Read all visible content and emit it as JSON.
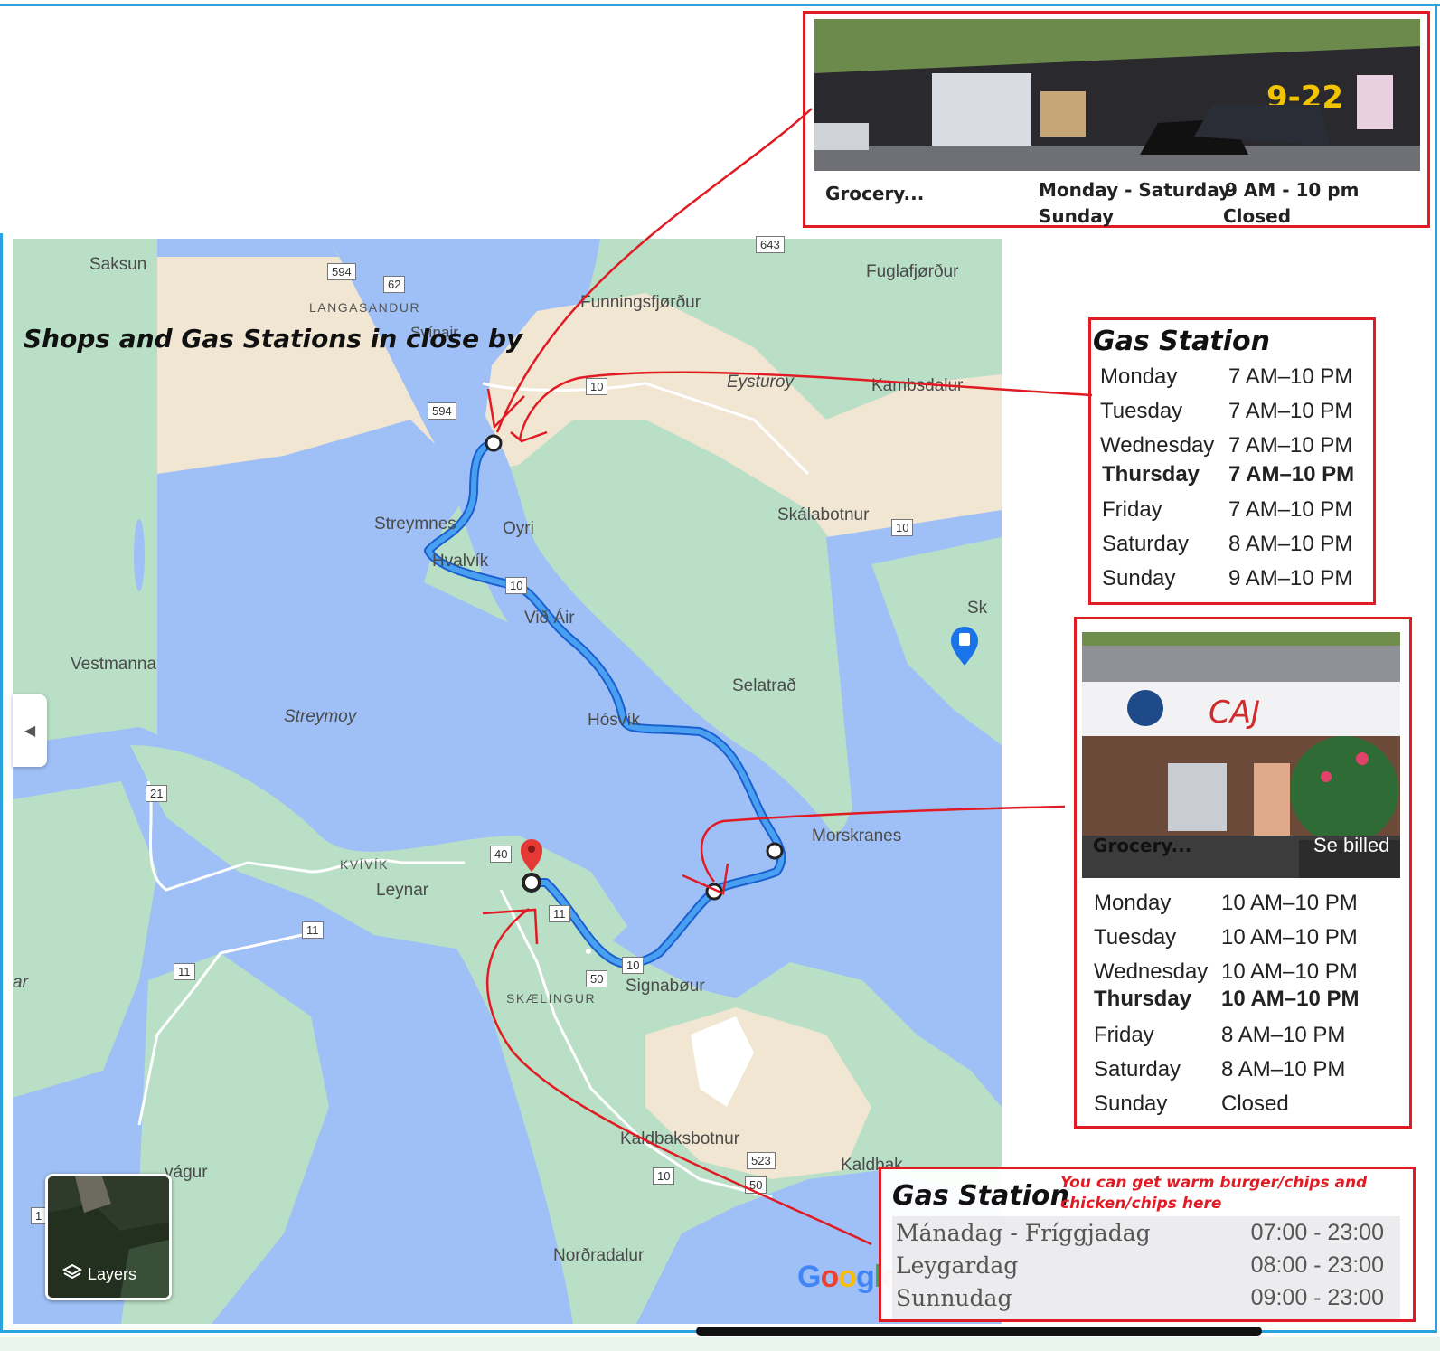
{
  "map": {
    "title": "Shops and Gas Stations in close by",
    "places": [
      {
        "id": "saksun",
        "name": "Saksun"
      },
      {
        "id": "langasandur",
        "name": "LANGASANDUR"
      },
      {
        "id": "svinair",
        "name": "Svínair"
      },
      {
        "id": "funningsfjordur",
        "name": "Funningsfjørður"
      },
      {
        "id": "fuglafjordur",
        "name": "Fuglafjørður"
      },
      {
        "id": "eysturoy",
        "name": "Eysturoy"
      },
      {
        "id": "kambsdalur",
        "name": "Kambsdalur"
      },
      {
        "id": "streymnes",
        "name": "Streymnes"
      },
      {
        "id": "oyri",
        "name": "Oyri"
      },
      {
        "id": "hvalvik",
        "name": "Hvalvík"
      },
      {
        "id": "skalabotnur",
        "name": "Skálabotnur"
      },
      {
        "id": "vidair",
        "name": "Við Áir"
      },
      {
        "id": "sk",
        "name": "Sk"
      },
      {
        "id": "vestmanna",
        "name": "Vestmanna"
      },
      {
        "id": "selatrad",
        "name": "Selatrað"
      },
      {
        "id": "streymoy",
        "name": "Streymoy"
      },
      {
        "id": "hosvik",
        "name": "Hósvík"
      },
      {
        "id": "morskranes",
        "name": "Morskranes"
      },
      {
        "id": "kvivik",
        "name": "KVÍVÍK"
      },
      {
        "id": "leynar",
        "name": "Leynar"
      },
      {
        "id": "signabour",
        "name": "Signabøur"
      },
      {
        "id": "skaelingur",
        "name": "SKÆLINGUR"
      },
      {
        "id": "ar",
        "name": "ar"
      },
      {
        "id": "kaldbaksbotnur",
        "name": "Kaldbaksbotnur"
      },
      {
        "id": "vagur",
        "name": "vágur"
      },
      {
        "id": "kaldbak",
        "name": "Kaldbak"
      },
      {
        "id": "nordradalur",
        "name": "Norðradalur"
      }
    ],
    "roads": [
      "594",
      "62",
      "643",
      "10",
      "594",
      "10",
      "10",
      "21",
      "40",
      "11",
      "11",
      "11",
      "10",
      "50",
      "523",
      "10",
      "50",
      "1"
    ],
    "layers_label": "Layers",
    "logo": "Google",
    "colors": {
      "water": "#9ec0f7",
      "land": "#b9dfc6",
      "mountain": "#f0e6d2",
      "route": "#1a73e8",
      "marker": "#e53935",
      "annotation": "#e01b24"
    }
  },
  "grocery1": {
    "name": "Grocery...",
    "rows": [
      {
        "day": "Monday - Saturday",
        "hours": "9 AM - 10 pm"
      },
      {
        "day": "Sunday",
        "hours": "Closed"
      }
    ],
    "sign": "9-22"
  },
  "gas1": {
    "title": "Gas Station",
    "rows": [
      {
        "day": "Monday",
        "hours": "7 AM–10 PM",
        "bold": false
      },
      {
        "day": "Tuesday",
        "hours": "7 AM–10 PM",
        "bold": false
      },
      {
        "day": "Wednesday",
        "hours": "7 AM–10 PM",
        "bold": false
      },
      {
        "day": "Thursday",
        "hours": "7 AM–10 PM",
        "bold": true
      },
      {
        "day": "Friday",
        "hours": "7 AM–10 PM",
        "bold": false
      },
      {
        "day": "Saturday",
        "hours": "8 AM–10 PM",
        "bold": false
      },
      {
        "day": "Sunday",
        "hours": "9 AM–10 PM",
        "bold": false
      }
    ]
  },
  "grocery2": {
    "name": "Grocery...",
    "photo_button": "Se billed",
    "rows": [
      {
        "day": "Monday",
        "hours": "10 AM–10 PM",
        "bold": false
      },
      {
        "day": "Tuesday",
        "hours": "10 AM–10 PM",
        "bold": false
      },
      {
        "day": "Wednesday",
        "hours": "10 AM–10 PM",
        "bold": false
      },
      {
        "day": "Thursday",
        "hours": "10 AM–10 PM",
        "bold": true
      },
      {
        "day": "Friday",
        "hours": "8 AM–10 PM",
        "bold": false
      },
      {
        "day": "Saturday",
        "hours": "8 AM–10 PM",
        "bold": false
      },
      {
        "day": "Sunday",
        "hours": "Closed",
        "bold": false
      }
    ]
  },
  "gas2": {
    "title": "Gas Station",
    "note": "You can get warm burger/chips and chicken/chips here",
    "rows": [
      {
        "day": "Mánadag - Fríggjadag",
        "hours": "07:00 - 23:00"
      },
      {
        "day": "Leygardag",
        "hours": "08:00 - 23:00"
      },
      {
        "day": "Sunnudag",
        "hours": "09:00 - 23:00"
      }
    ]
  }
}
